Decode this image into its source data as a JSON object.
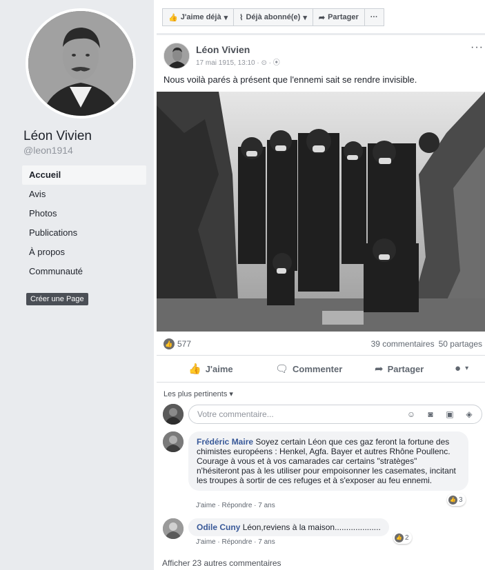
{
  "profile": {
    "name": "Léon Vivien",
    "handle": "@leon1914",
    "create_page_label": "Créer une Page"
  },
  "sidebar": {
    "items": [
      {
        "label": "Accueil",
        "active": true
      },
      {
        "label": "Avis",
        "active": false
      },
      {
        "label": "Photos",
        "active": false
      },
      {
        "label": "Publications",
        "active": false
      },
      {
        "label": "À propos",
        "active": false
      },
      {
        "label": "Communauté",
        "active": false
      }
    ]
  },
  "action_bar": {
    "like_label": "J'aime déjà",
    "follow_label": "Déjà abonné(e)",
    "share_label": "Partager",
    "more_label": "···"
  },
  "post": {
    "author": "Léon Vivien",
    "timestamp": "17 mai 1915, 13:10 · ⊙ · ⦿",
    "text": "Nous voilà parés à présent que l'ennemi sait se rendre invisible.",
    "more_label": "···",
    "reaction_count": "577",
    "comments_count": "39 commentaires",
    "shares_count": "50 partages",
    "actions": {
      "like": "J'aime",
      "comment": "Commenter",
      "share": "Partager"
    }
  },
  "comments": {
    "sort_label": "Les plus pertinents ▾",
    "input_placeholder": "Votre commentaire...",
    "items": [
      {
        "author": "Frédéric Maire",
        "text": "Soyez certain Léon que ces gaz feront la fortune des chimistes européens : Henkel, Agfa. Bayer et autres Rhône Poullenc. Courage à vous et à vos camarades car certains \"stratèges\" n'hésiteront pas à les utiliser pour empoisonner les casemates, incitant les troupes à sortir de ces refuges et à s'exposer au feu ennemi.",
        "actions": "J'aime · Répondre · 7 ans",
        "reactions": "3"
      },
      {
        "author": "Odile Cuny",
        "text": "Léon,reviens à la maison....................",
        "actions": "J'aime · Répondre · 7 ans",
        "reactions": "2"
      }
    ],
    "more_label": "Afficher 23 autres commentaires"
  },
  "colors": {
    "sidebar_bg": "#e9ebee",
    "link": "#385898",
    "muted": "#90949c"
  }
}
